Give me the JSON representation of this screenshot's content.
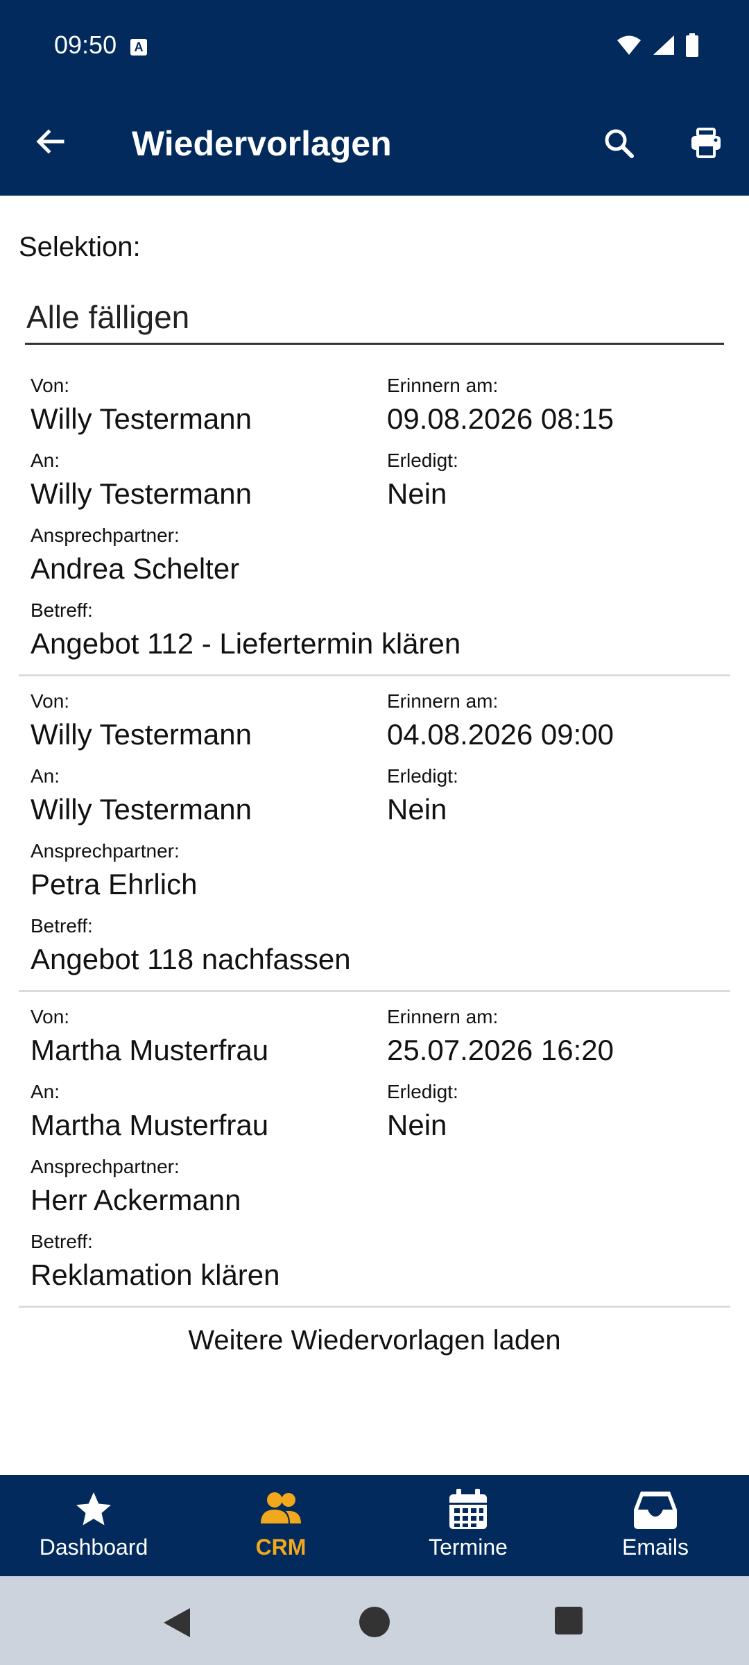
{
  "status_bar": {
    "time": "09:50",
    "notif_icon": "A"
  },
  "app_bar": {
    "title": "Wiedervorlagen"
  },
  "selection": {
    "label": "Selektion:",
    "value": "Alle fälligen"
  },
  "labels": {
    "von": "Von:",
    "an": "An:",
    "ansprechpartner": "Ansprechpartner:",
    "betreff": "Betreff:",
    "erinnern": "Erinnern am:",
    "erledigt": "Erledigt:"
  },
  "records": [
    {
      "von": "Willy Testermann",
      "an": "Willy Testermann",
      "ansprechpartner": "Andrea Schelter",
      "betreff": "Angebot 112 - Liefertermin klären",
      "erinnern": "09.08.2026 08:15",
      "erledigt": "Nein"
    },
    {
      "von": "Willy Testermann",
      "an": "Willy Testermann",
      "ansprechpartner": "Petra Ehrlich",
      "betreff": "Angebot 118 nachfassen",
      "erinnern": "04.08.2026 09:00",
      "erledigt": "Nein"
    },
    {
      "von": "Martha Musterfrau",
      "an": "Martha Musterfrau",
      "ansprechpartner": "Herr Ackermann",
      "betreff": "Reklamation klären",
      "erinnern": "25.07.2026 16:20",
      "erledigt": "Nein"
    }
  ],
  "load_more": "Weitere Wiedervorlagen laden",
  "bottom_nav": {
    "items": [
      {
        "label": "Dashboard",
        "icon": "star-icon"
      },
      {
        "label": "CRM",
        "icon": "people-icon",
        "active": true
      },
      {
        "label": "Termine",
        "icon": "calendar-icon"
      },
      {
        "label": "Emails",
        "icon": "inbox-icon"
      }
    ]
  },
  "colors": {
    "primary": "#022a5c",
    "accent": "#f2a81d",
    "system_nav": "#cdd3dc"
  }
}
